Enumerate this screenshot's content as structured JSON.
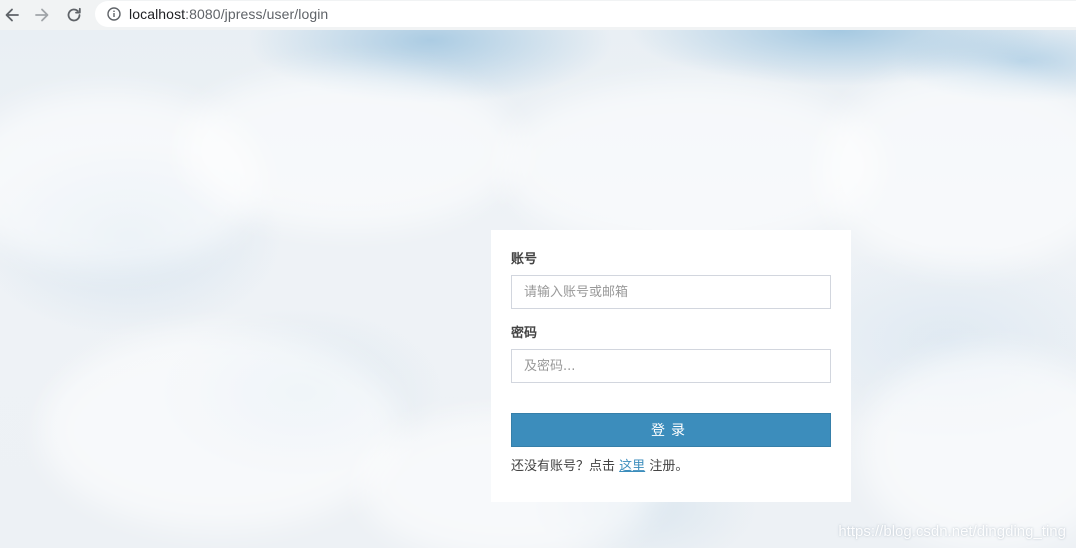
{
  "browser": {
    "url_host": "localhost",
    "url_rest": ":8080/jpress/user/login"
  },
  "icons": {
    "back": "arrow-left-icon",
    "forward": "arrow-right-icon",
    "reload": "reload-icon",
    "info": "info-icon"
  },
  "login": {
    "account_label": "账号",
    "account_placeholder": "请输入账号或邮箱",
    "password_label": "密码",
    "password_placeholder": "及密码...",
    "submit_label": "登录",
    "register_prefix": "还没有账号？点击",
    "register_link": "这里",
    "register_suffix": "注册。"
  },
  "watermark": "https://blog.csdn.net/dingding_ting",
  "colors": {
    "primary": "#3c8dbc",
    "toolbar": "#f1f3f4"
  }
}
